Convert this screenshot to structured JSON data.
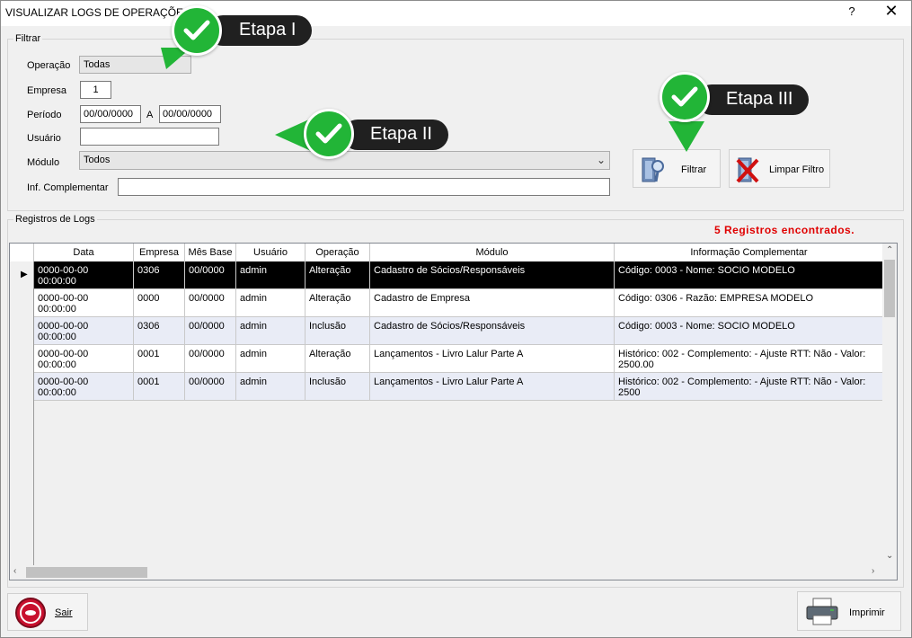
{
  "window": {
    "title": "VISUALIZAR LOGS DE OPERAÇÕES",
    "help": "?",
    "close": "✕"
  },
  "filter": {
    "legend": "Filtrar",
    "operacao_label": "Operação",
    "operacao_value": "Todas",
    "empresa_label": "Empresa",
    "empresa_value": "1",
    "periodo_label": "Período",
    "periodo_from": "00/00/0000",
    "periodo_sep": "A",
    "periodo_to": "00/00/0000",
    "usuario_label": "Usuário",
    "usuario_value": "",
    "modulo_label": "Módulo",
    "modulo_value": "Todos",
    "inf_label": "Inf. Complementar",
    "inf_value": "",
    "filtrar_button": "Filtrar",
    "limpar_button": "Limpar Filtro"
  },
  "callouts": {
    "etapa1": "Etapa I",
    "etapa2": "Etapa II",
    "etapa3": "Etapa III"
  },
  "logs": {
    "legend": "Registros de Logs",
    "count_text": "5 Registros encontrados.",
    "columns": [
      "Data",
      "Empresa",
      "Mês Base",
      "Usuário",
      "Operação",
      "Módulo",
      "Informação Complementar"
    ],
    "rows": [
      [
        "0000-00-00 00:00:00",
        "0306",
        "00/0000",
        "admin",
        "Alteração",
        "Cadastro de Sócios/Responsáveis",
        "Código: 0003 - Nome: SOCIO MODELO"
      ],
      [
        "0000-00-00 00:00:00",
        "0000",
        "00/0000",
        "admin",
        "Alteração",
        "Cadastro de Empresa",
        "Código: 0306 - Razão: EMPRESA MODELO"
      ],
      [
        "0000-00-00 00:00:00",
        "0306",
        "00/0000",
        "admin",
        "Inclusão",
        "Cadastro de Sócios/Responsáveis",
        "Código: 0003 - Nome: SOCIO MODELO"
      ],
      [
        "0000-00-00 00:00:00",
        "0001",
        "00/0000",
        "admin",
        "Alteração",
        "Lançamentos - Livro Lalur Parte A",
        "Histórico: 002 - Complemento:  - Ajuste RTT: Não - Valor: 2500.00"
      ],
      [
        "0000-00-00 00:00:00",
        "0001",
        "00/0000",
        "admin",
        "Inclusão",
        "Lançamentos - Livro Lalur Parte A",
        "Histórico: 002 - Complemento:  - Ajuste RTT: Não - Valor: 2500"
      ]
    ]
  },
  "footer": {
    "sair_button": "Sair",
    "imprimir_button": "Imprimir"
  },
  "colors": {
    "accent_red": "#e00000",
    "check_green": "#22b537",
    "selected_row": "#000000",
    "alt_row": "#e9ecf6"
  }
}
